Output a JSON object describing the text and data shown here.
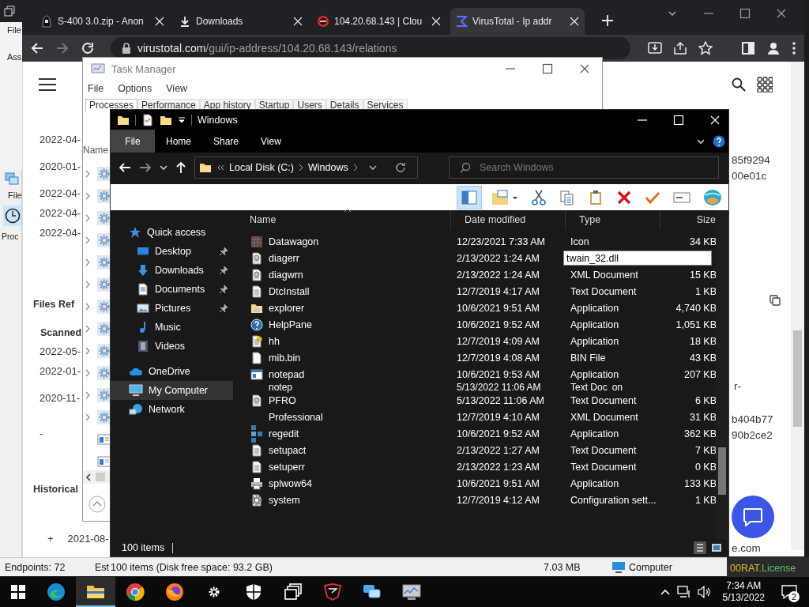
{
  "back_window": {
    "menu": "File",
    "label": "Ass"
  },
  "browser": {
    "tabs": [
      {
        "title": "S-400 3.0.zip - Anon",
        "kind": "figure",
        "selected": false
      },
      {
        "title": "Downloads",
        "kind": "download",
        "selected": false
      },
      {
        "title": "104.20.68.143 | Clou",
        "kind": "blocked",
        "selected": false
      },
      {
        "title": "VirusTotal - Ip addr",
        "kind": "sigma",
        "selected": true
      }
    ],
    "url_host": "virustotal.com",
    "url_path": "/gui/ip-address/104.20.68.143/relations",
    "page": {
      "left": {
        "dates": [
          "2022-04-",
          "2020-01-",
          "2022-04-",
          "2022-04-",
          "2022-04-"
        ],
        "files_heading": "Files Ref",
        "scanned_heading": "Scanned",
        "scanned_dates": [
          "2022-05-",
          "2022-01-",
          "2020-11-"
        ],
        "dash": "-",
        "historical_heading": "Historical",
        "expand": "+",
        "last_date": "2021-08-"
      },
      "right": {
        "hashes_top": [
          "85f9294",
          "00e01c"
        ],
        "note": "r-",
        "hashes_bottom": [
          "b404b77",
          "90b2ce2"
        ],
        "link": "e.com"
      }
    }
  },
  "side_window": {
    "menu": "File",
    "label": "Proc"
  },
  "task_manager": {
    "title": "Task Manager",
    "menu": [
      "File",
      "Options",
      "View"
    ],
    "tabs": [
      {
        "label": "Processes",
        "selected": true
      },
      {
        "label": "Performance",
        "selected": false
      },
      {
        "label": "App history",
        "selected": false
      },
      {
        "label": "Startup",
        "selected": false
      },
      {
        "label": "Users",
        "selected": false
      },
      {
        "label": "Details",
        "selected": false
      },
      {
        "label": "Services",
        "selected": false
      }
    ],
    "column": "Name",
    "processes": [
      {
        "kind": "service",
        "expandable": true
      },
      {
        "kind": "service",
        "expandable": true
      },
      {
        "kind": "service",
        "expandable": true
      },
      {
        "kind": "service",
        "expandable": true
      },
      {
        "kind": "service",
        "expandable": true
      },
      {
        "kind": "service",
        "expandable": true
      },
      {
        "kind": "service",
        "expandable": true
      },
      {
        "kind": "service",
        "expandable": true
      },
      {
        "kind": "service",
        "expandable": true
      },
      {
        "kind": "service",
        "expandable": true
      },
      {
        "kind": "service",
        "expandable": true
      },
      {
        "kind": "service",
        "expandable": true
      },
      {
        "kind": "window",
        "expandable": false
      },
      {
        "kind": "window",
        "expandable": false
      }
    ]
  },
  "explorer": {
    "title": "Windows",
    "ribbon_tabs": [
      {
        "label": "File",
        "selected": true
      },
      {
        "label": "Home",
        "selected": false
      },
      {
        "label": "Share",
        "selected": false
      },
      {
        "label": "View",
        "selected": false
      }
    ],
    "breadcrumbs": [
      "Local Disk (C:)",
      "Windows"
    ],
    "search": {
      "placeholder": "Search Windows"
    },
    "toolbar": [
      {
        "kind": "pane",
        "selected": true
      },
      {
        "kind": "new-folder",
        "selected": false
      },
      {
        "kind": "cut",
        "selected": false
      },
      {
        "kind": "copy",
        "selected": false
      },
      {
        "kind": "paste",
        "selected": false
      },
      {
        "kind": "delete",
        "selected": false
      },
      {
        "kind": "check",
        "selected": false
      },
      {
        "kind": "rename",
        "selected": false
      },
      {
        "kind": "globe",
        "selected": false
      }
    ],
    "nav": [
      {
        "label": "Quick access",
        "kind": "star",
        "selected": false,
        "children": [
          {
            "label": "Desktop",
            "kind": "desktop",
            "pinned": true,
            "selected": false
          },
          {
            "label": "Downloads",
            "kind": "downloads",
            "pinned": true,
            "selected": false
          },
          {
            "label": "Documents",
            "kind": "documents",
            "pinned": true,
            "selected": false
          },
          {
            "label": "Pictures",
            "kind": "pictures",
            "pinned": true,
            "selected": false
          },
          {
            "label": "Music",
            "kind": "music",
            "pinned": false,
            "selected": false
          },
          {
            "label": "Videos",
            "kind": "videos",
            "pinned": false,
            "selected": false
          }
        ]
      },
      {
        "label": "OneDrive",
        "kind": "cloud",
        "selected": false
      },
      {
        "label": "My Computer",
        "kind": "computer",
        "selected": true
      },
      {
        "label": "Network",
        "kind": "network",
        "selected": false
      }
    ],
    "columns": [
      "Name",
      "Date modified",
      "Type",
      "Size"
    ],
    "files": [
      {
        "kind": "image",
        "name": "Datawagon",
        "date": "12/23/2021 7:33 AM",
        "type": "Icon",
        "size": "34 KB"
      },
      {
        "kind": "xml",
        "name": "diagerr",
        "date": "2/13/2022 1:24 AM",
        "rename": "twain_32.dll"
      },
      {
        "kind": "xml",
        "name": "diagwrn",
        "date": "2/13/2022 1:24 AM",
        "type": "XML Document",
        "size": "15 KB"
      },
      {
        "kind": "text",
        "name": "DtcInstall",
        "date": "12/7/2019 4:17 AM",
        "type": "Text Document",
        "size": "1 KB"
      },
      {
        "kind": "app-folder",
        "name": "explorer",
        "date": "10/6/2021 9:51 AM",
        "type": "Application",
        "size": "4,740 KB"
      },
      {
        "kind": "help",
        "name": "HelpPane",
        "date": "10/6/2021 9:52 AM",
        "type": "Application",
        "size": "1,051 KB"
      },
      {
        "kind": "hh",
        "name": "hh",
        "date": "12/7/2019 4:09 AM",
        "type": "Application",
        "size": "18 KB"
      },
      {
        "kind": "blank",
        "name": "mib.bin",
        "date": "12/7/2019 4:08 AM",
        "type": "BIN File",
        "size": "43 KB"
      },
      {
        "kind": "app-window",
        "name": "notepad",
        "date": "10/6/2021 9:53 AM",
        "type": "Application",
        "size": "207 KB"
      },
      {
        "kind": "ghost",
        "name": "notep",
        "date": "5/13/2022 11:06 AM",
        "type": "Text Doc",
        "fragment": "on"
      },
      {
        "kind": "xml",
        "name": "PFRO",
        "date": "5/13/2022 11:06 AM",
        "type": "Text Document",
        "size": "6 KB"
      },
      {
        "kind": "none",
        "name": "Professional",
        "date": "12/7/2019 4:10 AM",
        "type": "XML Document",
        "size": "31 KB"
      },
      {
        "kind": "regedit",
        "name": "regedit",
        "date": "10/6/2021 9:52 AM",
        "type": "Application",
        "size": "362 KB"
      },
      {
        "kind": "text",
        "name": "setupact",
        "date": "2/13/2022 1:27 AM",
        "type": "Text Document",
        "size": "7 KB"
      },
      {
        "kind": "text",
        "name": "setuperr",
        "date": "2/13/2022 1:23 AM",
        "type": "Text Document",
        "size": "0 KB"
      },
      {
        "kind": "printer",
        "name": "splwow64",
        "date": "10/6/2021 9:51 AM",
        "type": "Application",
        "size": "133 KB"
      },
      {
        "kind": "settings",
        "name": "system",
        "date": "12/7/2019 4:12 AM",
        "type": "Configuration sett...",
        "size": "1 KB"
      }
    ],
    "status": "100 items",
    "views": [
      {
        "kind": "details",
        "selected": true
      },
      {
        "kind": "tiles",
        "selected": false
      }
    ]
  },
  "status_bar": {
    "endpoints": "Endpoints: 72",
    "est": "Est",
    "items": "100 items (Disk free space: 93.2 GB)",
    "size": "7.03 MB",
    "location": "Computer"
  },
  "license": {
    "name": "00RAT",
    "ext": ".License"
  },
  "taskbar": {
    "apps": [
      {
        "kind": "edge",
        "active": false
      },
      {
        "kind": "explorer",
        "active": true
      },
      {
        "kind": "chrome",
        "active": false
      },
      {
        "kind": "firefox",
        "active": false
      },
      {
        "kind": "settings",
        "active": false
      },
      {
        "kind": "shield",
        "active": false
      },
      {
        "kind": "windows",
        "active": false
      },
      {
        "kind": "emblem",
        "active": false
      },
      {
        "kind": "chat",
        "active": false
      },
      {
        "kind": "monitor",
        "active": false
      }
    ],
    "time": "7:34 AM",
    "date": "5/13/2022",
    "notifications": "2"
  }
}
